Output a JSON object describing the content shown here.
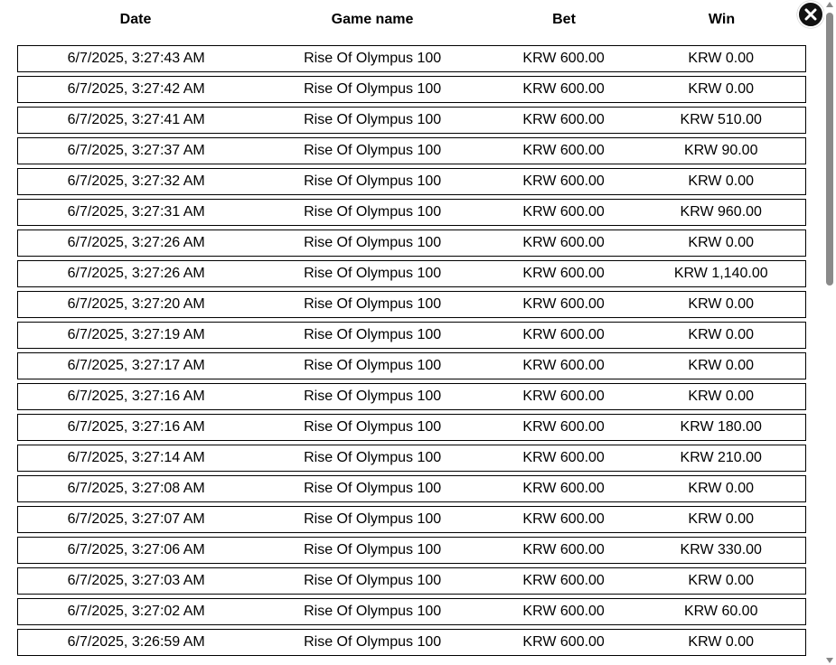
{
  "headers": {
    "date": "Date",
    "game": "Game name",
    "bet": "Bet",
    "win": "Win"
  },
  "rows": [
    {
      "date": "6/7/2025, 3:27:43 AM",
      "game": "Rise Of Olympus 100",
      "bet": "KRW 600.00",
      "win": "KRW 0.00"
    },
    {
      "date": "6/7/2025, 3:27:42 AM",
      "game": "Rise Of Olympus 100",
      "bet": "KRW 600.00",
      "win": "KRW 0.00"
    },
    {
      "date": "6/7/2025, 3:27:41 AM",
      "game": "Rise Of Olympus 100",
      "bet": "KRW 600.00",
      "win": "KRW 510.00"
    },
    {
      "date": "6/7/2025, 3:27:37 AM",
      "game": "Rise Of Olympus 100",
      "bet": "KRW 600.00",
      "win": "KRW 90.00"
    },
    {
      "date": "6/7/2025, 3:27:32 AM",
      "game": "Rise Of Olympus 100",
      "bet": "KRW 600.00",
      "win": "KRW 0.00"
    },
    {
      "date": "6/7/2025, 3:27:31 AM",
      "game": "Rise Of Olympus 100",
      "bet": "KRW 600.00",
      "win": "KRW 960.00"
    },
    {
      "date": "6/7/2025, 3:27:26 AM",
      "game": "Rise Of Olympus 100",
      "bet": "KRW 600.00",
      "win": "KRW 0.00"
    },
    {
      "date": "6/7/2025, 3:27:26 AM",
      "game": "Rise Of Olympus 100",
      "bet": "KRW 600.00",
      "win": "KRW 1,140.00"
    },
    {
      "date": "6/7/2025, 3:27:20 AM",
      "game": "Rise Of Olympus 100",
      "bet": "KRW 600.00",
      "win": "KRW 0.00"
    },
    {
      "date": "6/7/2025, 3:27:19 AM",
      "game": "Rise Of Olympus 100",
      "bet": "KRW 600.00",
      "win": "KRW 0.00"
    },
    {
      "date": "6/7/2025, 3:27:17 AM",
      "game": "Rise Of Olympus 100",
      "bet": "KRW 600.00",
      "win": "KRW 0.00"
    },
    {
      "date": "6/7/2025, 3:27:16 AM",
      "game": "Rise Of Olympus 100",
      "bet": "KRW 600.00",
      "win": "KRW 0.00"
    },
    {
      "date": "6/7/2025, 3:27:16 AM",
      "game": "Rise Of Olympus 100",
      "bet": "KRW 600.00",
      "win": "KRW 180.00"
    },
    {
      "date": "6/7/2025, 3:27:14 AM",
      "game": "Rise Of Olympus 100",
      "bet": "KRW 600.00",
      "win": "KRW 210.00"
    },
    {
      "date": "6/7/2025, 3:27:08 AM",
      "game": "Rise Of Olympus 100",
      "bet": "KRW 600.00",
      "win": "KRW 0.00"
    },
    {
      "date": "6/7/2025, 3:27:07 AM",
      "game": "Rise Of Olympus 100",
      "bet": "KRW 600.00",
      "win": "KRW 0.00"
    },
    {
      "date": "6/7/2025, 3:27:06 AM",
      "game": "Rise Of Olympus 100",
      "bet": "KRW 600.00",
      "win": "KRW 330.00"
    },
    {
      "date": "6/7/2025, 3:27:03 AM",
      "game": "Rise Of Olympus 100",
      "bet": "KRW 600.00",
      "win": "KRW 0.00"
    },
    {
      "date": "6/7/2025, 3:27:02 AM",
      "game": "Rise Of Olympus 100",
      "bet": "KRW 600.00",
      "win": "KRW 60.00"
    },
    {
      "date": "6/7/2025, 3:26:59 AM",
      "game": "Rise Of Olympus 100",
      "bet": "KRW 600.00",
      "win": "KRW 0.00"
    }
  ],
  "icons": {
    "close": "close-icon"
  },
  "colors": {
    "close_button_bg": "#111111",
    "scroll_thumb": "#8a8a8a",
    "row_border": "#000000"
  }
}
